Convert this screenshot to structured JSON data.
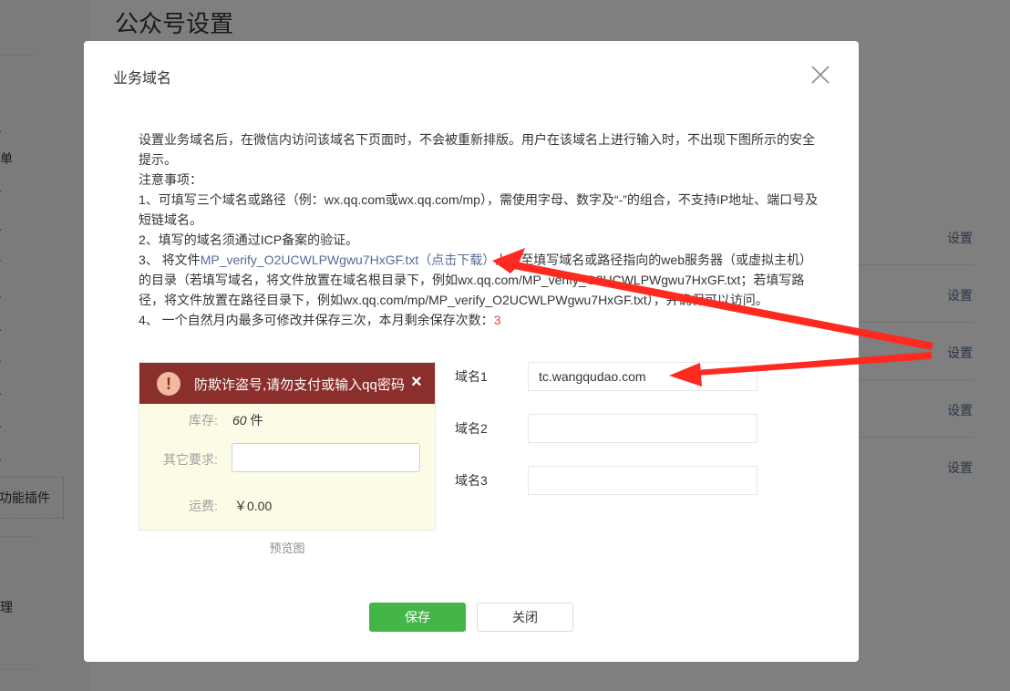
{
  "page": {
    "title": "公众号设置",
    "left_nav_fragments": [
      "单",
      "功能插件",
      "理"
    ],
    "row_action_label": "设置",
    "row_actions": [
      "设置",
      "设置",
      "设置",
      "设置",
      "设置"
    ]
  },
  "dialog": {
    "title": "业务域名",
    "description": {
      "intro": "设置业务域名后，在微信内访问该域名下页面时，不会被重新排版。用户在该域名上进行输入时，不出现下图所示的安全提示。",
      "notes_heading": "注意事项：",
      "note1": "1、可填写三个域名或路径（例：wx.qq.com或wx.qq.com/mp），需使用字母、数字及“-”的组合，不支持IP地址、端口号及短链域名。",
      "note2": "2、填写的域名须通过ICP备案的验证。",
      "note3_prefix": "3、 将文件",
      "note3_file": "MP_verify_O2UCWLPWgwu7HxGF.txt",
      "note3_download": "（点击下载）",
      "note3_rest": "上传至填写域名或路径指向的web服务器（或虚拟主机）的目录（若填写域名，将文件放置在域名根目录下，例如wx.qq.com/MP_verify_O2UCWLPWgwu7HxGF.txt；若填写路径，将文件放置在路径目录下，例如wx.qq.com/mp/MP_verify_O2UCWLPWgwu7HxGF.txt），并确保可以访问。",
      "note4_prefix": "4、 一个自然月内最多可修改并保存三次，本月剩余保存次数：",
      "note4_count": "3"
    },
    "preview": {
      "warning_icon": "!",
      "warning_text": "防欺诈盗号,请勿支付或输入qq密码",
      "warning_close": "×",
      "stock_label": "库存:",
      "stock_value": "60",
      "stock_unit": "件",
      "other_label": "其它要求:",
      "shipping_label": "运费:",
      "shipping_value": "￥0.00",
      "caption": "预览图"
    },
    "domains": [
      {
        "label": "域名1",
        "value": "tc.wangqudao.com"
      },
      {
        "label": "域名2",
        "value": ""
      },
      {
        "label": "域名3",
        "value": ""
      }
    ],
    "buttons": {
      "save": "保存",
      "close": "关闭"
    }
  },
  "colors": {
    "overlay": "#000000",
    "link": "#576b95",
    "save_green": "#44b549",
    "warning_bar": "#8b2f2c",
    "annotation_arrow": "#ff2a1f",
    "count_red": "#e64340"
  },
  "icons": {
    "dialog_close": "close-icon",
    "warning": "warning-icon"
  }
}
